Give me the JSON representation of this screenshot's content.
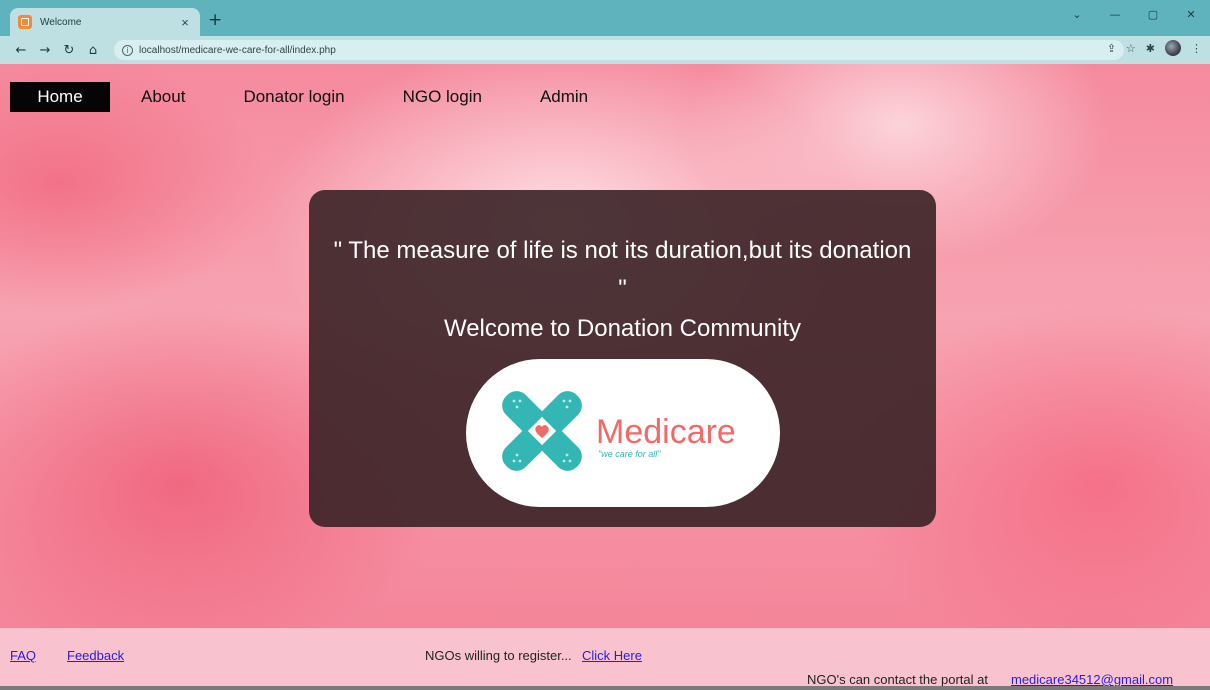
{
  "browser": {
    "tab_title": "Welcome",
    "tab_close": "×",
    "new_tab": "+",
    "url": "localhost/medicare-we-care-for-all/index.php",
    "window_controls": [
      "⌄",
      "—",
      "▢",
      "✕"
    ]
  },
  "nav": {
    "home": "Home",
    "about": "About",
    "donator_login": "Donator login",
    "ngo_login": "NGO login",
    "admin": "Admin"
  },
  "hero": {
    "quote": "\" The measure of life is not its duration,but its donation \"",
    "welcome": "Welcome to Donation Community",
    "logo_name": "Medicare",
    "logo_tagline": "\"we care for all\""
  },
  "footer": {
    "faq": "FAQ",
    "feedback": "Feedback",
    "register_text": "NGOs willing to register...",
    "register_link": "Click Here",
    "contact_text": "NGO's can contact the portal at ",
    "contact_email": "medicare34512@gmail.com"
  },
  "colors": {
    "tabstrip": "#5fb3bd",
    "nav_active_bg": "#050505",
    "card_bg": "#3a2226",
    "logo_teal": "#34b7b4",
    "logo_coral": "#f06a68",
    "link": "#2a1bd6"
  }
}
